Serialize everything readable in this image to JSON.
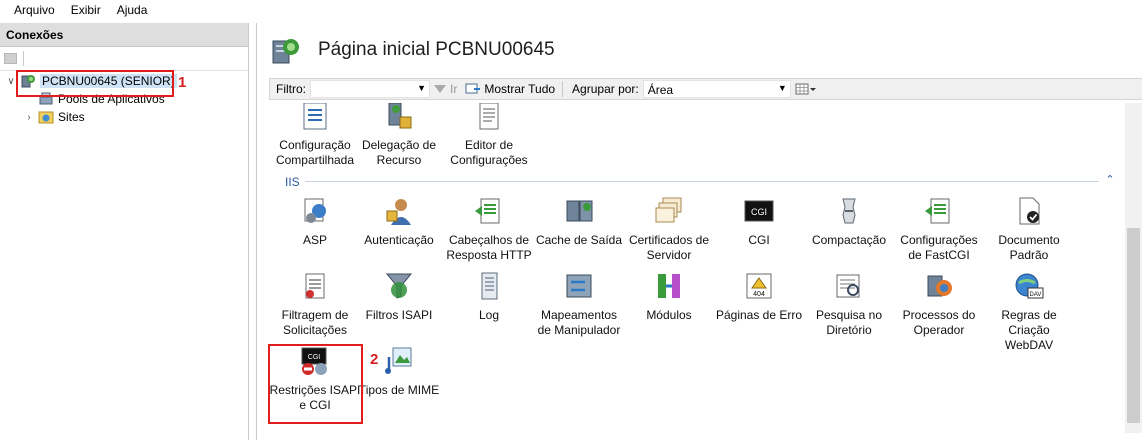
{
  "menu": [
    "Arquivo",
    "Exibir",
    "Ajuda"
  ],
  "connections": {
    "title": "Conexões",
    "server": "PCBNU00645 (SENIOR)",
    "children": [
      "Pools de Aplicativos",
      "Sites"
    ]
  },
  "main": {
    "title": "Página inicial PCBNU00645",
    "filter": {
      "label": "Filtro:",
      "value": "",
      "go_label": "Ir",
      "show_all": "Mostrar Tudo",
      "group_by_label": "Agrupar por:",
      "group_by_value": "Área"
    },
    "top_features": [
      {
        "label": "Configuração Compartilhada",
        "icon": "shared-config-icon"
      },
      {
        "label": "Delegação de Recurso",
        "icon": "feature-delegation-icon"
      },
      {
        "label": "Editor de Configurações",
        "icon": "config-editor-icon"
      }
    ],
    "group": "IIS",
    "iis_features": [
      {
        "label": "ASP",
        "icon": "asp-icon"
      },
      {
        "label": "Autenticação",
        "icon": "authentication-icon"
      },
      {
        "label": "Cabeçalhos de Resposta HTTP",
        "icon": "http-headers-icon"
      },
      {
        "label": "Cache de Saída",
        "icon": "output-cache-icon"
      },
      {
        "label": "Certificados de Servidor",
        "icon": "server-certificates-icon"
      },
      {
        "label": "CGI",
        "icon": "cgi-icon"
      },
      {
        "label": "Compactação",
        "icon": "compression-icon"
      },
      {
        "label": "Configurações de FastCGI",
        "icon": "fastcgi-icon"
      },
      {
        "label": "Documento Padrão",
        "icon": "default-document-icon"
      },
      {
        "label": "Filtragem de Solicitações",
        "icon": "request-filtering-icon"
      },
      {
        "label": "Filtros ISAPI",
        "icon": "isapi-filters-icon"
      },
      {
        "label": "Log",
        "icon": "log-icon"
      },
      {
        "label": "Mapeamentos de Manipulador",
        "icon": "handler-mappings-icon"
      },
      {
        "label": "Módulos",
        "icon": "modules-icon"
      },
      {
        "label": "Páginas de Erro",
        "icon": "error-pages-icon"
      },
      {
        "label": "Pesquisa no Diretório",
        "icon": "directory-browsing-icon"
      },
      {
        "label": "Processos do Operador",
        "icon": "worker-processes-icon"
      },
      {
        "label": "Regras de Criação WebDAV",
        "icon": "webdav-icon"
      },
      {
        "label": "Restrições ISAPI e CGI",
        "icon": "isapi-cgi-restrictions-icon"
      },
      {
        "label": "Tipos de MIME",
        "icon": "mime-types-icon"
      }
    ]
  },
  "annotations": [
    "1",
    "2"
  ],
  "colors": {
    "annotation": "#e11c1c",
    "group_text": "#2a5a9a"
  }
}
